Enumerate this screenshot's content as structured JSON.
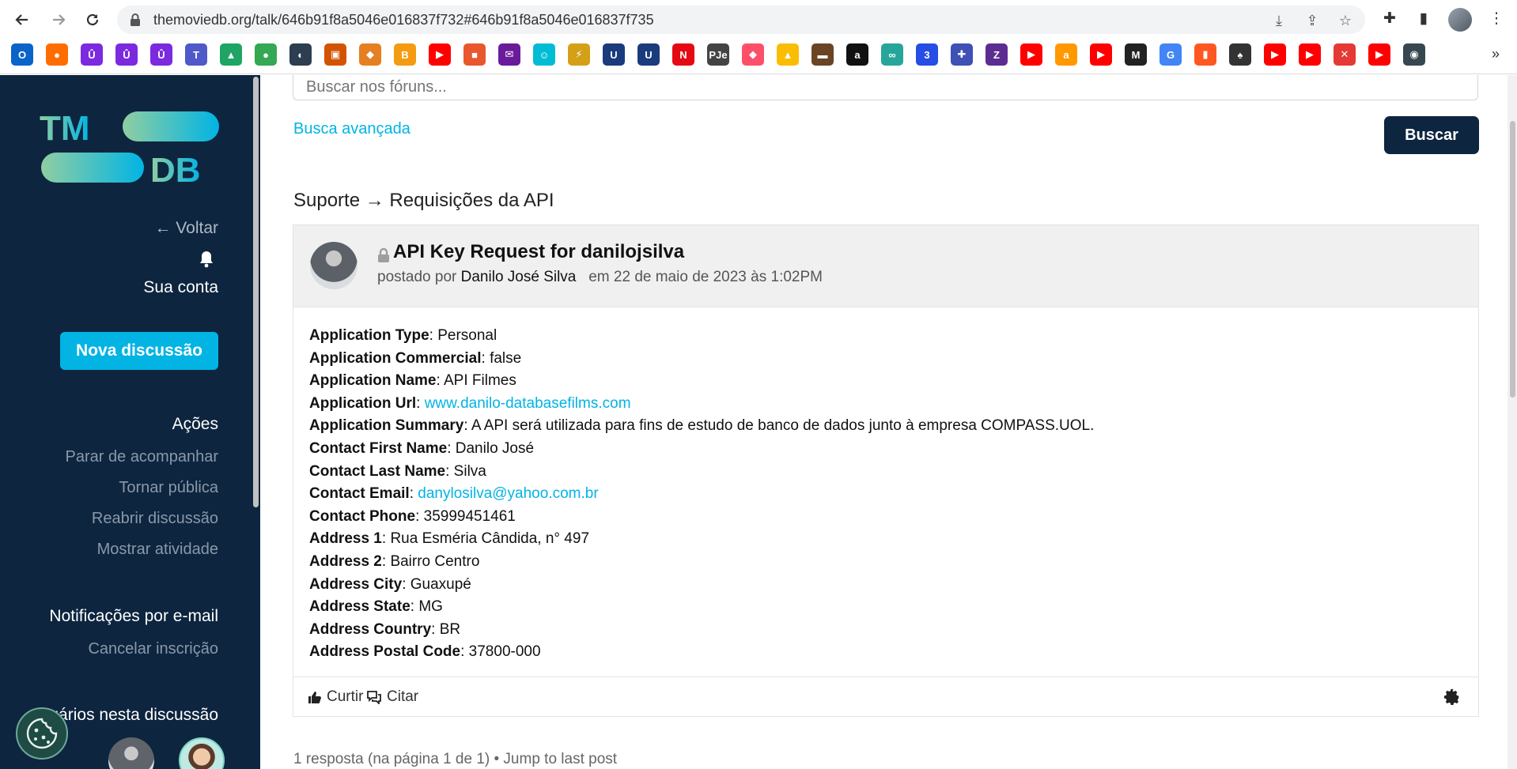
{
  "browser": {
    "url": "themoviedb.org/talk/646b91f8a5046e016837f732#646b91f8a5046e016837f735",
    "bookmarks": [
      {
        "icon": "outlook-icon",
        "color": "#0a64c8",
        "glyph": "O"
      },
      {
        "icon": "firefox-icon",
        "color": "#ff6d00",
        "glyph": "●"
      },
      {
        "icon": "purple-u-icon",
        "color": "#7b2ae0",
        "glyph": "Û"
      },
      {
        "icon": "purple-u-icon",
        "color": "#7b2ae0",
        "glyph": "Û"
      },
      {
        "icon": "purple-u-icon",
        "color": "#7b2ae0",
        "glyph": "Û"
      },
      {
        "icon": "teams-icon",
        "color": "#5059c9",
        "glyph": "T"
      },
      {
        "icon": "drive-icon",
        "color": "#1fa463",
        "glyph": "▲"
      },
      {
        "icon": "maps-icon",
        "color": "#34a853",
        "glyph": "●"
      },
      {
        "icon": "circle-icon",
        "color": "#2c3e50",
        "glyph": "◐"
      },
      {
        "icon": "contact-icon",
        "color": "#d35400",
        "glyph": "▣"
      },
      {
        "icon": "flame-icon",
        "color": "#e67e22",
        "glyph": "◆"
      },
      {
        "icon": "coin-icon",
        "color": "#f39c12",
        "glyph": "B"
      },
      {
        "icon": "youtube-icon",
        "color": "#ff0000",
        "glyph": "▶"
      },
      {
        "icon": "box-icon",
        "color": "#e8572e",
        "glyph": "■"
      },
      {
        "icon": "mail-icon",
        "color": "#6a1b9a",
        "glyph": "✉"
      },
      {
        "icon": "smiley-icon",
        "color": "#00bcd4",
        "glyph": "☺"
      },
      {
        "icon": "plug-icon",
        "color": "#d4a017",
        "glyph": "⚡"
      },
      {
        "icon": "u-shield-icon",
        "color": "#1a3c7c",
        "glyph": "U"
      },
      {
        "icon": "u-shield-icon",
        "color": "#1a3c7c",
        "glyph": "U"
      },
      {
        "icon": "netflix-icon",
        "color": "#e50914",
        "glyph": "N"
      },
      {
        "icon": "pje-icon",
        "color": "#444444",
        "glyph": "PJe"
      },
      {
        "icon": "tinder-icon",
        "color": "#fd5068",
        "glyph": "◆"
      },
      {
        "icon": "ads-icon",
        "color": "#fbbc04",
        "glyph": "▲"
      },
      {
        "icon": "food-icon",
        "color": "#6b4423",
        "glyph": "▬"
      },
      {
        "icon": "amazon-a-icon",
        "color": "#111111",
        "glyph": "a"
      },
      {
        "icon": "link-icon",
        "color": "#26a69a",
        "glyph": "∞"
      },
      {
        "icon": "css-icon",
        "color": "#264de4",
        "glyph": "3"
      },
      {
        "icon": "puzzle-icon",
        "color": "#3f51b5",
        "glyph": "✚"
      },
      {
        "icon": "z-icon",
        "color": "#5c2d91",
        "glyph": "Z"
      },
      {
        "icon": "youtube-icon",
        "color": "#ff0000",
        "glyph": "▶"
      },
      {
        "icon": "amazon-icon",
        "color": "#ff9900",
        "glyph": "a"
      },
      {
        "icon": "youtube-icon",
        "color": "#ff0000",
        "glyph": "▶"
      },
      {
        "icon": "mpc-icon",
        "color": "#222222",
        "glyph": "M"
      },
      {
        "icon": "google-icon",
        "color": "#4285f4",
        "glyph": "G"
      },
      {
        "icon": "tie-icon",
        "color": "#ff5722",
        "glyph": "▮"
      },
      {
        "icon": "spade-icon",
        "color": "#333333",
        "glyph": "♠"
      },
      {
        "icon": "youtube-icon",
        "color": "#ff0000",
        "glyph": "▶"
      },
      {
        "icon": "youtube-icon",
        "color": "#ff0000",
        "glyph": "▶"
      },
      {
        "icon": "tools-icon",
        "color": "#e53935",
        "glyph": "✕"
      },
      {
        "icon": "youtube-icon",
        "color": "#ff0000",
        "glyph": "▶"
      },
      {
        "icon": "globe-icon",
        "color": "#37474f",
        "glyph": "◉"
      }
    ]
  },
  "sidebar": {
    "back": "← Voltar",
    "account": "Sua conta",
    "new_discussion": "Nova discussão",
    "actions_title": "Ações",
    "actions": [
      "Parar de acompanhar",
      "Tornar pública",
      "Reabrir discussão",
      "Mostrar atividade"
    ],
    "email_title": "Notificações por e-mail",
    "unsubscribe": "Cancelar inscrição",
    "users_title": "uários nesta discussão"
  },
  "search": {
    "placeholder": "Buscar nos fóruns...",
    "advanced": "Busca avançada",
    "button": "Buscar"
  },
  "breadcrumb": "Suporte → Requisições da API",
  "post": {
    "title": "API Key Request for danilojsilva",
    "posted_by": "postado por",
    "author": "Danilo José Silva",
    "date": "em 22 de maio de 2023 às 1:02PM",
    "fields": [
      {
        "key": "Application Type",
        "value": "Personal",
        "link": false
      },
      {
        "key": "Application Commercial",
        "value": "false",
        "link": false
      },
      {
        "key": "Application Name",
        "value": "API Filmes",
        "link": false
      },
      {
        "key": "Application Url",
        "value": "www.danilo-databasefilms.com",
        "link": true
      },
      {
        "key": "Application Summary",
        "value": "A API será utilizada para fins de estudo de banco de dados junto à empresa COMPASS.UOL.",
        "link": false
      },
      {
        "key": "Contact First Name",
        "value": "Danilo José",
        "link": false
      },
      {
        "key": "Contact Last Name",
        "value": "Silva",
        "link": false
      },
      {
        "key": "Contact Email",
        "value": "danylosilva@yahoo.com.br",
        "link": true
      },
      {
        "key": "Contact Phone",
        "value": "35999451461",
        "link": false
      },
      {
        "key": "Address 1",
        "value": "Rua Esméria Cândida, n° 497",
        "link": false
      },
      {
        "key": "Address 2",
        "value": "Bairro Centro",
        "link": false
      },
      {
        "key": "Address City",
        "value": "Guaxupé",
        "link": false
      },
      {
        "key": "Address State",
        "value": "MG",
        "link": false
      },
      {
        "key": "Address Country",
        "value": "BR",
        "link": false
      },
      {
        "key": "Address Postal Code",
        "value": "37800-000",
        "link": false
      }
    ],
    "like": "Curtir",
    "quote": "Citar"
  },
  "reply_count": "1 resposta (na página 1 de 1) • Jump to last post"
}
